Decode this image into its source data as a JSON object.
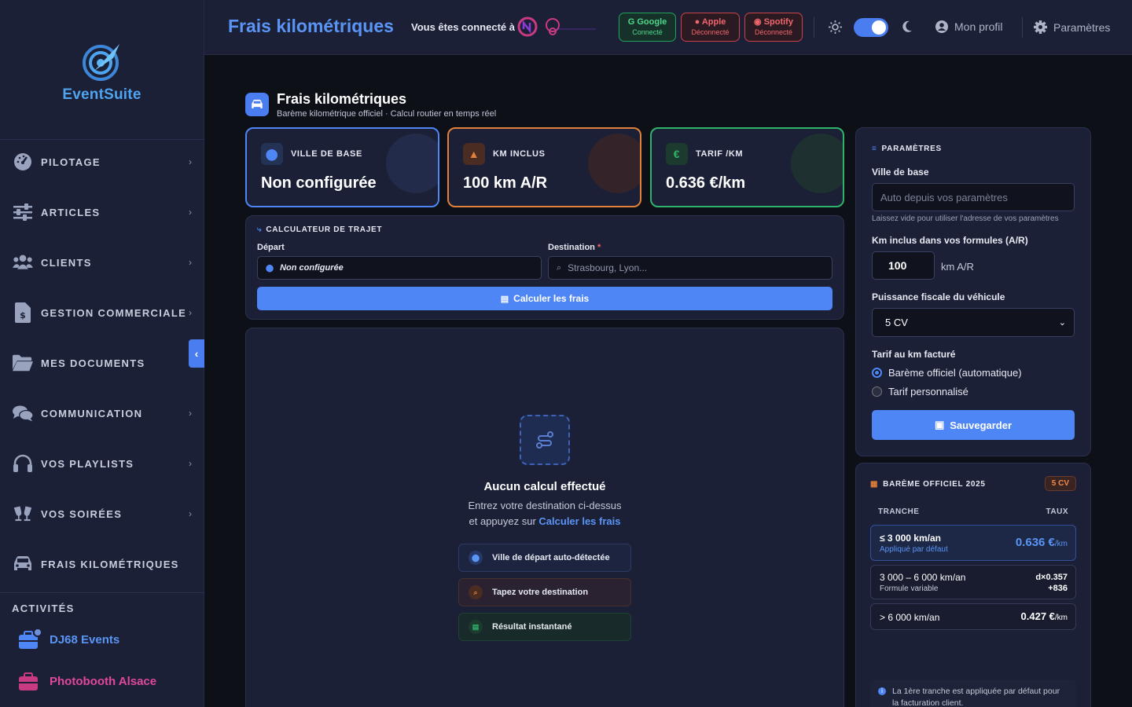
{
  "sidebar": {
    "brand": "EventSuite",
    "items": [
      {
        "label": "PILOTAGE",
        "icon": "gauge-icon"
      },
      {
        "label": "ARTICLES",
        "icon": "sliders-icon"
      },
      {
        "label": "CLIENTS",
        "icon": "users-icon"
      },
      {
        "label": "GESTION COMMERCIALE",
        "icon": "invoice-icon"
      },
      {
        "label": "MES DOCUMENTS",
        "icon": "folder-icon"
      },
      {
        "label": "COMMUNICATION",
        "icon": "chat-icon"
      },
      {
        "label": "VOS PLAYLISTS",
        "icon": "headphones-icon"
      },
      {
        "label": "VOS SOIRÉES",
        "icon": "glasses-icon"
      },
      {
        "label": "FRAIS KILOMÉTRIQUES",
        "icon": "car-icon"
      }
    ],
    "activities_title": "ACTIVITÉS",
    "activities": [
      {
        "label": "DJ68 Events",
        "color": "#5a95f5"
      },
      {
        "label": "Photobooth Alsace",
        "color": "#e0489a"
      }
    ]
  },
  "header": {
    "title": "Frais kilométriques",
    "connected_label": "Vous êtes connecté à",
    "services": [
      {
        "name": "Google",
        "status": "Connecté"
      },
      {
        "name": "Apple",
        "status": "Déconnecté"
      },
      {
        "name": "Spotify",
        "status": "Déconnecté"
      }
    ],
    "profile": "Mon profil",
    "settings": "Paramètres"
  },
  "page": {
    "title": "Frais kilométriques",
    "subtitle": "Barème kilométrique officiel · Calcul routier en temps réel"
  },
  "stats": [
    {
      "label": "VILLE DE BASE",
      "value": "Non configurée",
      "color": "#4f86f5"
    },
    {
      "label": "KM INCLUS",
      "value": "100 km A/R",
      "color": "#e0803a"
    },
    {
      "label": "TARIF /KM",
      "value": "0.636 €/km",
      "color": "#2fb36a"
    }
  ],
  "calculator": {
    "title": "CALCULATEUR DE TRAJET",
    "depart_label": "Départ",
    "depart_value": "Non configurée",
    "destination_label": "Destination",
    "required_mark": "*",
    "destination_placeholder": "Strasbourg, Lyon...",
    "button": "Calculer les frais"
  },
  "empty_state": {
    "title": "Aucun calcul effectué",
    "line1": "Entrez votre destination ci-dessus",
    "line2_prefix": "et appuyez sur",
    "line2_link": "Calculer les frais",
    "steps": [
      "Ville de départ auto-détectée",
      "Tapez votre destination",
      "Résultat instantané"
    ]
  },
  "settings_panel": {
    "title": "PARAMÈTRES",
    "base_city_label": "Ville de base",
    "base_city_placeholder": "Auto depuis vos paramètres",
    "base_city_hint": "Laissez vide pour utiliser l'adresse de vos paramètres",
    "km_label": "Km inclus dans vos formules (A/R)",
    "km_value": "100",
    "km_unit": "km A/R",
    "power_label": "Puissance fiscale du véhicule",
    "power_value": "5 CV",
    "rate_label": "Tarif au km facturé",
    "rate_options": [
      "Barème officiel (automatique)",
      "Tarif personnalisé"
    ],
    "rate_selected": "Barème officiel (automatique)",
    "save_button": "Sauvegarder"
  },
  "bareme": {
    "title": "BARÈME OFFICIEL 2025",
    "badge": "5 CV",
    "col_tranche": "TRANCHE",
    "col_taux": "TAUX",
    "rows": [
      {
        "tranche": "≤ 3 000 km/an",
        "note": "Appliqué par défaut",
        "rate": "0.636 €",
        "unit": "/km"
      },
      {
        "tranche": "3 000 – 6 000 km/an",
        "note": "Formule variable",
        "rate": "d×0.357",
        "rate2": "+836"
      },
      {
        "tranche": "> 6 000 km/an",
        "rate": "0.427 €",
        "unit": "/km"
      }
    ],
    "info": "La 1ère tranche est appliquée par défaut pour la facturation client."
  }
}
